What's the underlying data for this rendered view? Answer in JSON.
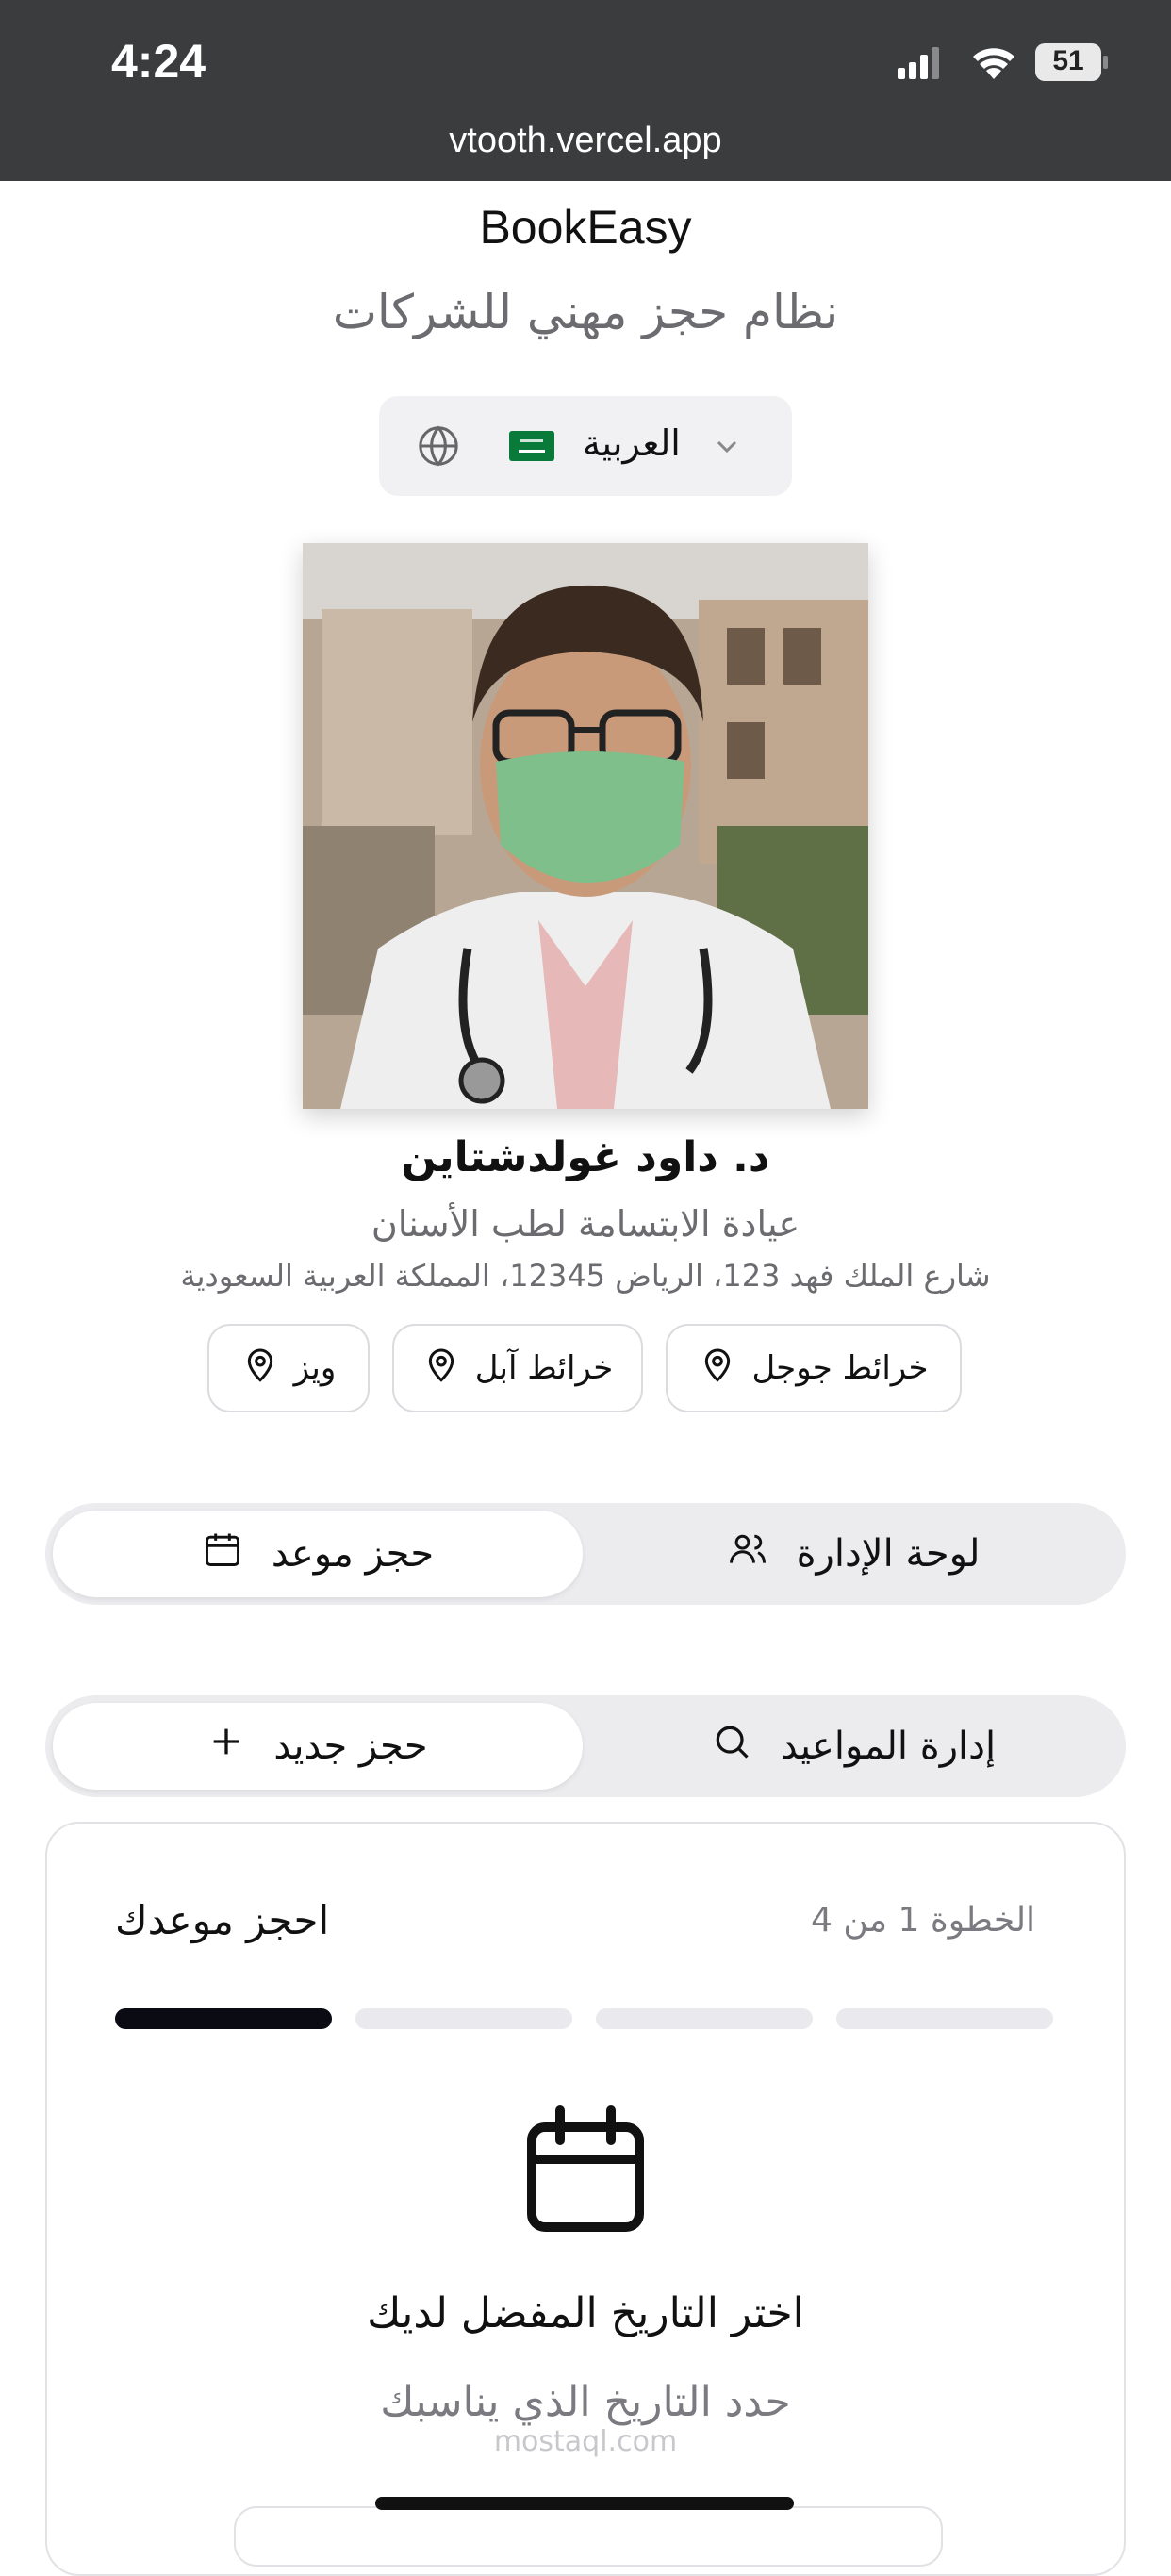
{
  "status_bar": {
    "time": "4:24",
    "battery": "51",
    "url": "vtooth.vercel.app"
  },
  "header": {
    "brand": "BookEasy",
    "tagline": "نظام حجز مهني للشركات"
  },
  "language": {
    "label": "العربية",
    "flag": "saudi-flag",
    "icon": "globe-icon"
  },
  "doctor": {
    "name": "د. داود غولدشتاين",
    "clinic": "عيادة الابتسامة لطب الأسنان",
    "address": "شارع الملك فهد 123، الرياض 12345، المملكة العربية السعودية"
  },
  "maps": {
    "google": "خرائط جوجل",
    "apple": "خرائط آبل",
    "waze": "ويز"
  },
  "main_tabs": {
    "booking": "حجز موعد",
    "admin": "لوحة الإدارة"
  },
  "sub_tabs": {
    "new_booking": "حجز جديد",
    "manage": "إدارة المواعيد"
  },
  "wizard": {
    "title": "احجز موعدك",
    "step_text": "الخطوة 1 من 4",
    "current_step": 1,
    "total_steps": 4,
    "heading": "اختر التاريخ المفضل لديك",
    "subheading": "حدد التاريخ الذي يناسبك"
  },
  "watermark": "mostaql.com",
  "colors": {
    "accent": "#0b0b14",
    "muted": "#6b6b70",
    "segment_bg": "#ececef",
    "statusbar": "#3b3c3e"
  }
}
